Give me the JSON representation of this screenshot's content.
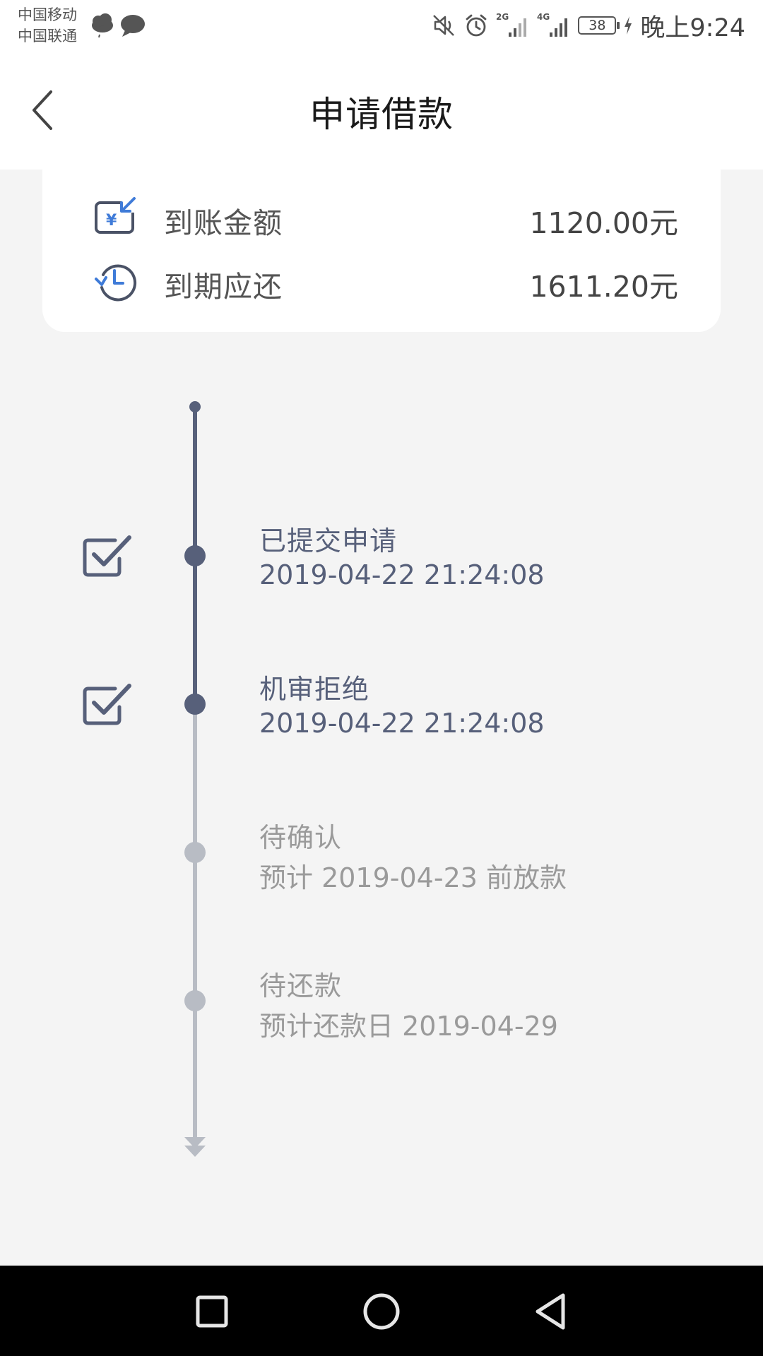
{
  "status_bar": {
    "carrier_1": "中国移动",
    "carrier_2": "中国联通",
    "network_1": "2G",
    "network_2": "4G",
    "battery_level": "38",
    "time": "晚上9:24",
    "icons": [
      "cloud-icon",
      "message-icon",
      "mute-icon",
      "alarm-icon",
      "signal-2g-icon",
      "signal-4g-icon",
      "battery-icon",
      "charging-icon"
    ]
  },
  "nav": {
    "title": "申请借款",
    "back_icon": "chevron-left-icon"
  },
  "summary": {
    "rows": [
      {
        "icon": "yen-transfer-icon",
        "label": "到账金额",
        "value": "1120.00元"
      },
      {
        "icon": "clock-return-icon",
        "label": "到期应还",
        "value": "1611.20元"
      }
    ]
  },
  "timeline": {
    "steps": [
      {
        "title": "已提交申请",
        "detail": "2019-04-22 21:24:08",
        "status": "done"
      },
      {
        "title": "机审拒绝",
        "detail": "2019-04-22 21:24:08",
        "status": "done"
      },
      {
        "title": "待确认",
        "detail": "预计 2019-04-23 前放款",
        "status": "pending"
      },
      {
        "title": "待还款",
        "detail": "预计还款日 2019-04-29",
        "status": "pending"
      }
    ]
  },
  "system_nav": {
    "buttons": [
      "recent-apps-icon",
      "home-icon",
      "back-triangle-icon"
    ]
  },
  "colors": {
    "done": "#57607a",
    "pending": "#b8bcc4",
    "accent_blue": "#3f7bd8",
    "icon_dark": "#4a5266",
    "background": "#f4f4f4"
  }
}
